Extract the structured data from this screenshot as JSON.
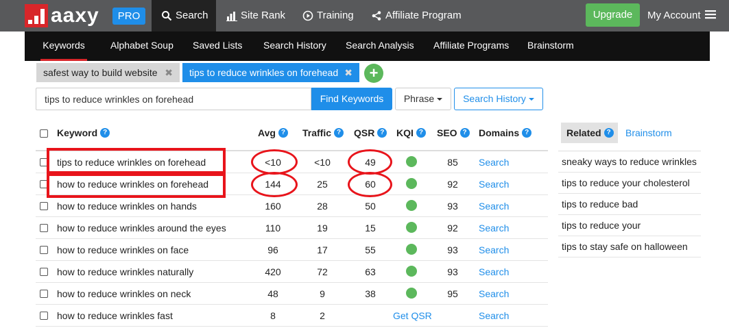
{
  "brand": {
    "logo_text": "aaxy",
    "badge": "PRO",
    "colors": {
      "red": "#d8262a",
      "blue": "#1f8ee9",
      "green": "#5cb85c",
      "nav": "#58595b"
    }
  },
  "topnav": {
    "items": [
      {
        "label": "Search",
        "icon": "search-icon"
      },
      {
        "label": "Site Rank",
        "icon": "bar-chart-icon"
      },
      {
        "label": "Training",
        "icon": "play-circle-icon"
      },
      {
        "label": "Affiliate Program",
        "icon": "share-icon"
      }
    ],
    "upgrade": "Upgrade",
    "account": "My Account"
  },
  "subnav": {
    "items": [
      "Keywords",
      "Alphabet Soup",
      "Saved Lists",
      "Search History",
      "Search Analysis",
      "Affiliate Programs",
      "Brainstorm"
    ]
  },
  "search_tabs": [
    {
      "label": "safest way to build website"
    },
    {
      "label": "tips to reduce wrinkles on forehead"
    }
  ],
  "search": {
    "value": "tips to reduce wrinkles on forehead",
    "find_label": "Find Keywords",
    "phrase_label": "Phrase",
    "history_label": "Search History"
  },
  "table": {
    "headers": {
      "keyword": "Keyword",
      "avg": "Avg",
      "traffic": "Traffic",
      "qsr": "QSR",
      "kqi": "KQI",
      "seo": "SEO",
      "domains": "Domains"
    },
    "rows": [
      {
        "keyword": "tips to reduce wrinkles on forehead",
        "avg": "<10",
        "traffic": "<10",
        "qsr": "49",
        "kqi": "green",
        "seo": "85",
        "domains": "Search"
      },
      {
        "keyword": "how to reduce wrinkles on forehead",
        "avg": "144",
        "traffic": "25",
        "qsr": "60",
        "kqi": "green",
        "seo": "92",
        "domains": "Search"
      },
      {
        "keyword": "how to reduce wrinkles on hands",
        "avg": "160",
        "traffic": "28",
        "qsr": "50",
        "kqi": "green",
        "seo": "93",
        "domains": "Search"
      },
      {
        "keyword": "how to reduce wrinkles around the eyes",
        "avg": "110",
        "traffic": "19",
        "qsr": "15",
        "kqi": "green",
        "seo": "92",
        "domains": "Search"
      },
      {
        "keyword": "how to reduce wrinkles on face",
        "avg": "96",
        "traffic": "17",
        "qsr": "55",
        "kqi": "green",
        "seo": "93",
        "domains": "Search"
      },
      {
        "keyword": "how to reduce wrinkles naturally",
        "avg": "420",
        "traffic": "72",
        "qsr": "63",
        "kqi": "green",
        "seo": "93",
        "domains": "Search"
      },
      {
        "keyword": "how to reduce wrinkles on neck",
        "avg": "48",
        "traffic": "9",
        "qsr": "38",
        "kqi": "green",
        "seo": "95",
        "domains": "Search"
      },
      {
        "keyword": "how to reduce wrinkles fast",
        "avg": "8",
        "traffic": "2",
        "qsr": "Get QSR",
        "kqi": "",
        "seo": "",
        "domains": "Search"
      }
    ]
  },
  "related": {
    "tab_label": "Related",
    "brainstorm_label": "Brainstorm",
    "items": [
      "sneaky ways to reduce wrinkles",
      "tips to reduce your cholesterol",
      "tips to reduce bad",
      "tips to reduce your",
      "tips to stay safe on halloween"
    ]
  }
}
